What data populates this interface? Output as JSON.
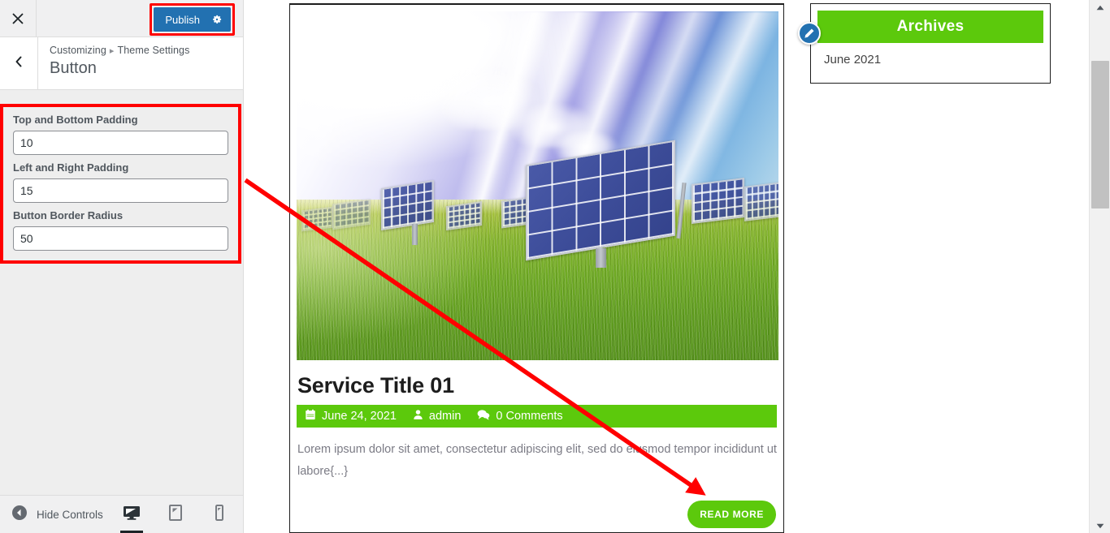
{
  "customizer": {
    "close_icon": "close-icon",
    "publish_label": "Publish",
    "publish_gear_icon": "gear-icon",
    "back_icon": "chevron-left-icon",
    "breadcrumb_root": "Customizing",
    "breadcrumb_separator": "▸",
    "breadcrumb_parent": "Theme Settings",
    "panel_title": "Button",
    "controls": [
      {
        "label": "Top and Bottom Padding",
        "value": "10",
        "name": "top-bottom-padding"
      },
      {
        "label": "Left and Right Padding",
        "value": "15",
        "name": "left-right-padding"
      },
      {
        "label": "Button Border Radius",
        "value": "50",
        "name": "button-border-radius"
      }
    ],
    "footer": {
      "hide_controls_label": "Hide Controls",
      "collapse_icon": "collapse-left-icon",
      "devices": [
        {
          "name": "desktop",
          "icon": "desktop-icon",
          "active": true
        },
        {
          "name": "tablet",
          "icon": "tablet-icon",
          "active": false
        },
        {
          "name": "mobile",
          "icon": "mobile-icon",
          "active": false
        }
      ]
    }
  },
  "preview": {
    "post": {
      "featured_image_alt": "solar-panel-field-photo",
      "title": "Service Title 01",
      "meta": {
        "date_icon": "calendar-icon",
        "date": "June 24, 2021",
        "author_icon": "user-icon",
        "author": "admin",
        "comments_icon": "comments-icon",
        "comments": "0 Comments"
      },
      "excerpt": "Lorem ipsum dolor sit amet, consectetur adipiscing elit, sed do eiusmod tempor incididunt ut labore{...}",
      "read_more_label": "READ MORE"
    },
    "widget": {
      "title": "Archives",
      "edit_icon": "pencil-edit-icon",
      "items": [
        "June 2021"
      ]
    }
  },
  "scrollbar": {
    "up_icon": "scroll-up-arrow-icon",
    "down_icon": "scroll-down-arrow-icon"
  },
  "colors": {
    "accent_green": "#5cc90c",
    "publish_blue": "#2271b1",
    "annotation_red": "#ff0000",
    "sidebar_bg": "#eeeeee"
  }
}
